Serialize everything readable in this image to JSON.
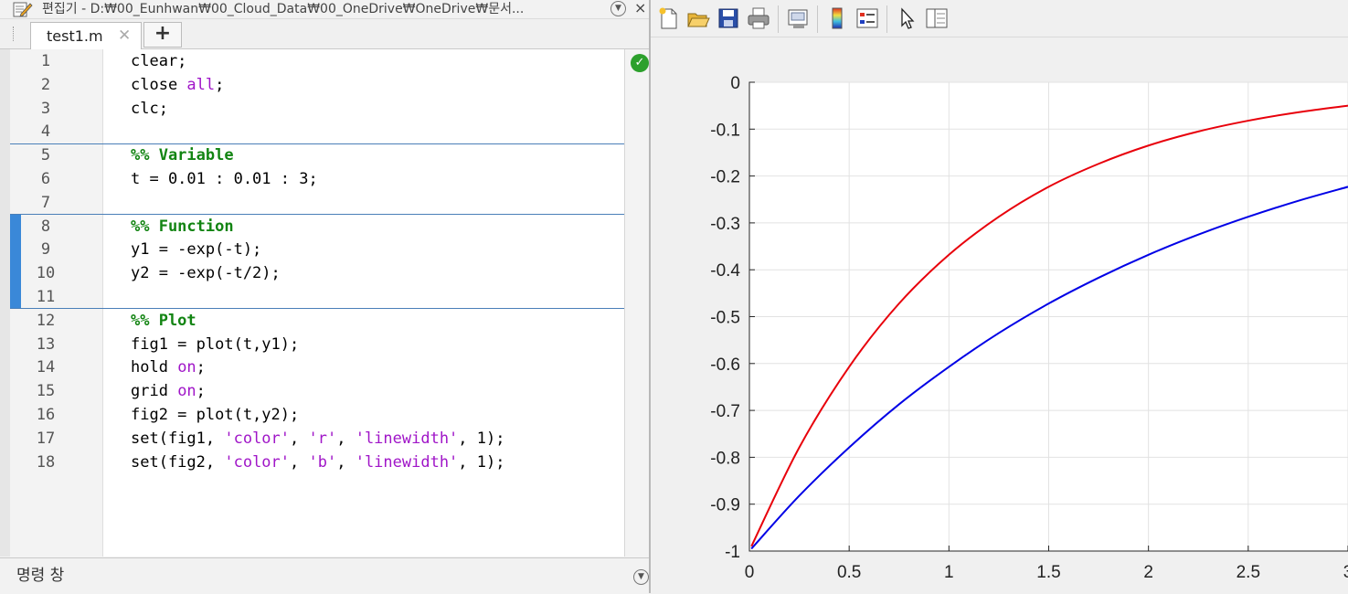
{
  "editor": {
    "title": "편집기 - D:₩00_Eunhwan₩00_Cloud_Data₩00_OneDrive₩OneDrive₩문서...",
    "tab_label": "test1.m",
    "tab_close": "✕",
    "tab_add": "+",
    "lines": [
      {
        "n": "1",
        "text": "clear;"
      },
      {
        "n": "2",
        "text": "close all;"
      },
      {
        "n": "3",
        "text": "clc;"
      },
      {
        "n": "4",
        "text": ""
      },
      {
        "n": "5",
        "text": "%% Variable"
      },
      {
        "n": "6",
        "text": "t = 0.01 : 0.01 : 3;"
      },
      {
        "n": "7",
        "text": ""
      },
      {
        "n": "8",
        "text": "%% Function"
      },
      {
        "n": "9",
        "text": "y1 = -exp(-t);"
      },
      {
        "n": "10",
        "text": "y2 = -exp(-t/2);"
      },
      {
        "n": "11",
        "text": ""
      },
      {
        "n": "12",
        "text": "%% Plot"
      },
      {
        "n": "13",
        "text": "fig1 = plot(t,y1);"
      },
      {
        "n": "14",
        "text": "hold on;"
      },
      {
        "n": "15",
        "text": "grid on;"
      },
      {
        "n": "16",
        "text": "fig2 = plot(t,y2);"
      },
      {
        "n": "17",
        "text": "set(fig1, 'color', 'r', 'linewidth', 1);"
      },
      {
        "n": "18",
        "text": "set(fig2, 'color', 'b', 'linewidth', 1);"
      }
    ],
    "command_window_label": "명령 창",
    "close_glyph": "×"
  },
  "figure": {
    "toolbar_icons": [
      "new-file-icon",
      "open-folder-icon",
      "save-icon",
      "print-icon",
      "link-plot-icon",
      "colorbar-icon",
      "legend-icon",
      "select-cursor-icon",
      "property-inspector-icon"
    ]
  },
  "chart_data": {
    "type": "line",
    "title": "",
    "xlabel": "",
    "ylabel": "",
    "xlim": [
      0,
      3
    ],
    "ylim": [
      -1,
      0
    ],
    "xticks": [
      "0",
      "0.5",
      "1",
      "1.5",
      "2",
      "2.5",
      "3"
    ],
    "yticks": [
      "0",
      "-0.1",
      "-0.2",
      "-0.3",
      "-0.4",
      "-0.5",
      "-0.6",
      "-0.7",
      "-0.8",
      "-0.9",
      "-1"
    ],
    "grid": true,
    "x": [
      0.01,
      0.25,
      0.5,
      0.75,
      1.0,
      1.25,
      1.5,
      1.75,
      2.0,
      2.25,
      2.5,
      2.75,
      3.0
    ],
    "series": [
      {
        "color": "#e8000b",
        "values": [
          -0.99,
          -0.779,
          -0.607,
          -0.472,
          -0.368,
          -0.287,
          -0.223,
          -0.174,
          -0.135,
          -0.105,
          -0.082,
          -0.064,
          -0.05
        ]
      },
      {
        "color": "#0000e6",
        "values": [
          -0.995,
          -0.882,
          -0.779,
          -0.687,
          -0.607,
          -0.535,
          -0.472,
          -0.417,
          -0.368,
          -0.325,
          -0.287,
          -0.253,
          -0.223
        ]
      }
    ]
  }
}
